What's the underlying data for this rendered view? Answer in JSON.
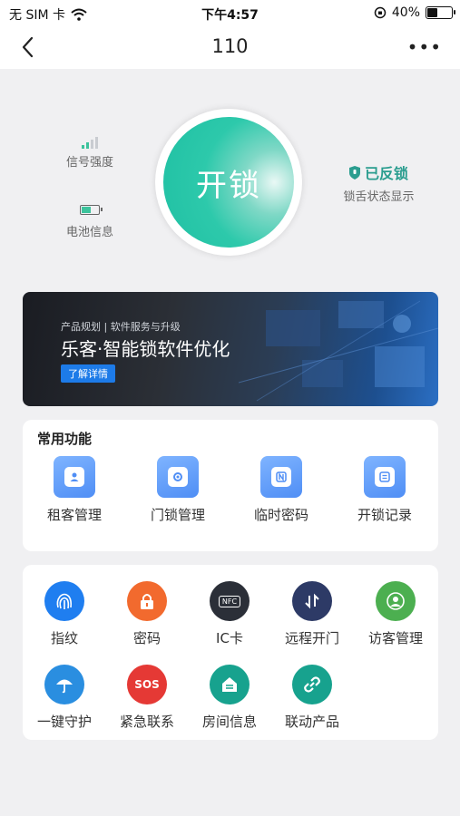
{
  "status_bar": {
    "carrier": "无 SIM 卡",
    "time": "下午4:57",
    "battery": "40%",
    "battery_level": 0.4
  },
  "nav": {
    "title": "110",
    "more": "•••"
  },
  "device": {
    "signal_label": "信号强度",
    "signal_bars_on": 2,
    "signal_bars_total": 4,
    "battery_label": "电池信息",
    "unlock_button": "开锁",
    "lock_state": "已反锁",
    "lock_state_sub": "锁舌状态显示",
    "accent_color": "#1fc0a3"
  },
  "banner": {
    "subtitle": "产品规划 | 软件服务与升级",
    "title": "乐客·智能锁软件优化",
    "button": "了解详情"
  },
  "common": {
    "title": "常用功能",
    "items": [
      {
        "label": "租客管理",
        "icon": "tenant-icon"
      },
      {
        "label": "门锁管理",
        "icon": "lock-settings-icon"
      },
      {
        "label": "临时密码",
        "icon": "temp-password-icon"
      },
      {
        "label": "开锁记录",
        "icon": "unlock-record-icon"
      }
    ]
  },
  "features": {
    "items": [
      {
        "label": "指纹",
        "icon": "fingerprint-icon",
        "color": "#1f7ef0"
      },
      {
        "label": "密码",
        "icon": "lock-password-icon",
        "color": "#f26a2e"
      },
      {
        "label": "IC卡",
        "icon": "nfc-card-icon",
        "color": "#2b2f38",
        "text": "NFC"
      },
      {
        "label": "远程开门",
        "icon": "remote-open-icon",
        "color": "#2d3a66"
      },
      {
        "label": "访客管理",
        "icon": "visitor-icon",
        "color": "#4caf50"
      },
      {
        "label": "一键守护",
        "icon": "umbrella-icon",
        "color": "#2a8ee0"
      },
      {
        "label": "紧急联系",
        "icon": "sos-icon",
        "color": "#e53935",
        "text": "SOS"
      },
      {
        "label": "房间信息",
        "icon": "room-info-icon",
        "color": "#17a28e"
      },
      {
        "label": "联动产品",
        "icon": "link-icon",
        "color": "#17a28e"
      }
    ]
  }
}
